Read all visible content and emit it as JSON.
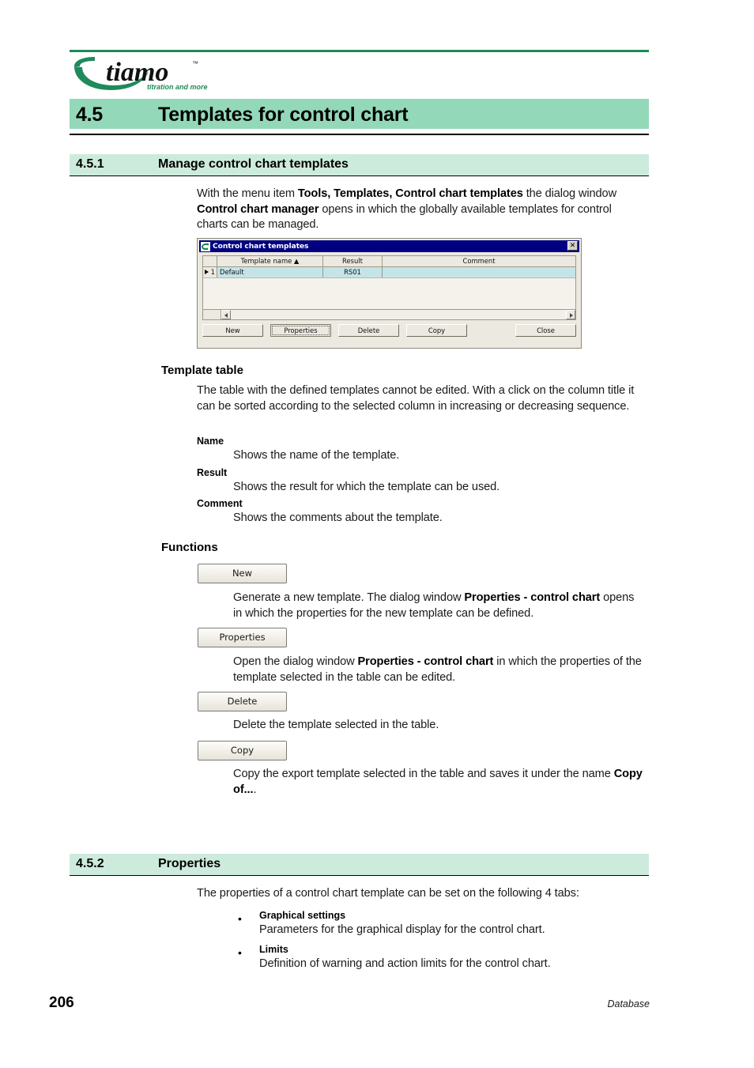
{
  "header": {
    "logo_text": "tiamo",
    "logo_tm": "™",
    "logo_tagline": "titration and more"
  },
  "section_45": {
    "number": "4.5",
    "title": "Templates for control chart"
  },
  "section_451": {
    "number": "4.5.1",
    "title": "Manage control chart templates",
    "intro_1": "With the menu item ",
    "intro_bold_1": "Tools, Templates, Control chart templates",
    "intro_2": " the dialog window ",
    "intro_bold_2": "Control chart manager",
    "intro_3": " opens in which the globally available templates for control charts can be managed."
  },
  "dialog": {
    "title": "Control chart templates",
    "icon": "tiamo-c-icon",
    "close_label": "✕",
    "columns": [
      "",
      "Template name  ▲",
      "Result",
      "Comment"
    ],
    "rows": [
      {
        "index": "1",
        "name": "Default",
        "result": "RS01",
        "comment": ""
      }
    ],
    "buttons": {
      "new": "New",
      "properties": "Properties",
      "delete": "Delete",
      "copy": "Copy",
      "close": "Close"
    }
  },
  "template_table": {
    "heading": "Template table",
    "body": "The table with the defined templates cannot be edited. With a click on the column title it can be sorted according to the selected column in increasing or decreasing sequence.",
    "defs": [
      {
        "label": "Name",
        "text": "Shows the name of the template."
      },
      {
        "label": "Result",
        "text": "Shows the result for which the template can be used."
      },
      {
        "label": "Comment",
        "text": "Shows the comments about the template."
      }
    ]
  },
  "functions": {
    "heading": "Functions",
    "new": {
      "button": "New",
      "text_1": "Generate a new template. The dialog window ",
      "bold": "Properties - control chart",
      "text_2": " opens in which the properties for the new template can be defined."
    },
    "properties": {
      "button": "Properties",
      "text_1": "Open the dialog window ",
      "bold": "Properties - control chart",
      "text_2": " in which the properties of the template selected in the table can be edited."
    },
    "delete": {
      "button": "Delete",
      "text_1": "Delete the template selected in the table."
    },
    "copy": {
      "button": "Copy",
      "text_1": "Copy the export template selected in the table and saves it under the name ",
      "bold": "Copy of...",
      "text_2": "."
    }
  },
  "section_452": {
    "number": "4.5.2",
    "title": "Properties",
    "intro": "The properties of a control chart template can be set on the following 4 tabs:",
    "bullets": [
      {
        "label": "Graphical settings",
        "text": "Parameters for the graphical display for the control chart."
      },
      {
        "label": "Limits",
        "text": "Definition of warning and action limits for the control chart."
      }
    ],
    "bullet_glyph": "•"
  },
  "footer": {
    "page_number": "206",
    "chapter": "Database"
  },
  "colors": {
    "brand_green": "#1F8A5A",
    "heading_band": "#93D9B9",
    "subheading_band": "#CDEBDC",
    "dialog_titlebar": "#000080",
    "row_selected": "#C5E4E8"
  }
}
